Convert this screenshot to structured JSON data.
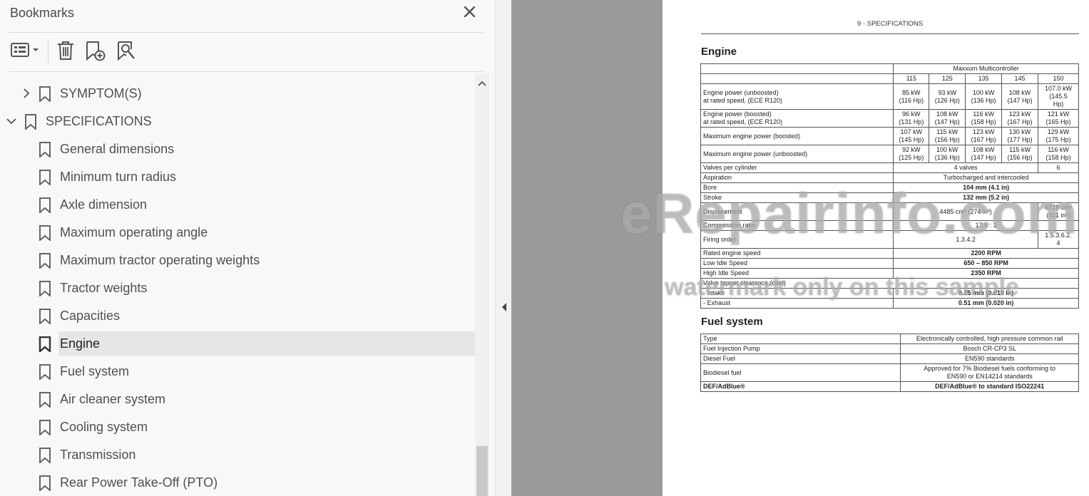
{
  "panel": {
    "title": "Bookmarks",
    "close_glyph": "✕",
    "toolbar": {
      "options_icon": "list-options-icon",
      "delete_icon": "trash-icon",
      "add_icon": "add-bookmark-icon",
      "find_icon": "find-bookmark-icon"
    },
    "items": [
      {
        "label": "SYMPTOM(S)",
        "level": 0,
        "expander": "collapsed"
      },
      {
        "label": "SPECIFICATIONS",
        "level": 0,
        "expander": "expanded"
      },
      {
        "label": "General dimensions",
        "level": 1
      },
      {
        "label": "Minimum turn radius",
        "level": 1
      },
      {
        "label": "Axle dimension",
        "level": 1
      },
      {
        "label": "Maximum operating angle",
        "level": 1
      },
      {
        "label": "Maximum tractor operating weights",
        "level": 1
      },
      {
        "label": "Tractor weights",
        "level": 1
      },
      {
        "label": "Capacities",
        "level": 1
      },
      {
        "label": "Engine",
        "level": 1,
        "selected": true
      },
      {
        "label": "Fuel system",
        "level": 1
      },
      {
        "label": "Air cleaner system",
        "level": 1
      },
      {
        "label": "Cooling system",
        "level": 1
      },
      {
        "label": "Transmission",
        "level": 1
      },
      {
        "label": "Rear Power Take-Off (PTO)",
        "level": 1
      }
    ]
  },
  "document": {
    "header": "9 - SPECIFICATIONS",
    "engine": {
      "title": "Engine",
      "group_header": "Maxxum Multicontroller",
      "models": [
        "115",
        "125",
        "135",
        "145",
        "150"
      ],
      "power_rows": [
        {
          "label": "Engine power (unboosted)\nat rated speed, (ECE R120)",
          "values": [
            "85 kW\n(116 Hp)",
            "93 kW\n(126 Hp)",
            "100 kW\n(136 Hp)",
            "108 kW\n(147 Hp)",
            "107.0 kW\n(145.5\nHp)"
          ]
        },
        {
          "label": "Engine power (boosted)\nat rated speed, (ECE R120)",
          "values": [
            "96 kW\n(131 Hp)",
            "108 kW\n(147 Hp)",
            "116 kW\n(158 Hp)",
            "123 kW\n(167 Hp)",
            "121 kW\n(165 Hp)"
          ]
        },
        {
          "label": "Maximum engine power (boosted)",
          "values": [
            "107 kW\n(145 Hp)",
            "115 kW\n(156 Hp)",
            "123 kW\n(167 Hp)",
            "130 kW\n(177 Hp)",
            "129 kW\n(175 Hp)"
          ]
        },
        {
          "label": "Maximum engine power (unboosted)",
          "values": [
            "92 kW\n(125 Hp)",
            "100 kW\n(136 Hp)",
            "108 kW\n(147 Hp)",
            "115 kW\n(156 Hp)",
            "116 kW\n(158 Hp)"
          ]
        }
      ],
      "valves": {
        "label": "Valves per cylinder",
        "left": "4 valves",
        "right": "6"
      },
      "aspiration": {
        "label": "Aspiration",
        "value": "Turbocharged and intercooled"
      },
      "bore": {
        "label": "Bore",
        "value": "104 mm (4.1 in)"
      },
      "stroke": {
        "label": "Stroke",
        "value": "132 mm (5.2 in)"
      },
      "displacement": {
        "label": "Displacement",
        "left": "4485 cm³ (274 in³)",
        "right": "6728 cm³\n(411 in³)"
      },
      "compression": {
        "label": "Compression ratio",
        "value": "17.5 : 1"
      },
      "firing": {
        "label": "Firing order",
        "left": "1.3.4.2",
        "right": "1.5.3.6.2.\n4"
      },
      "rated_speed": {
        "label": "Rated engine speed",
        "value": "2200 RPM"
      },
      "low_idle": {
        "label": "Low Idle Speed",
        "value": "650 – 850 RPM"
      },
      "high_idle": {
        "label": "High Idle Speed",
        "value": "2350 RPM"
      },
      "tappet": {
        "label": "Valve tappet clearance (cold)"
      },
      "intake": {
        "label": "- Intake",
        "value": "0.25 mm (0.010 in)"
      },
      "exhaust": {
        "label": "- Exhaust",
        "value": "0.51 mm (0.020 in)"
      }
    },
    "fuel": {
      "title": "Fuel system",
      "rows": [
        {
          "label": "Type",
          "value": "Electronically controlled, high pressure common rail",
          "bold": false
        },
        {
          "label": "Fuel Injection Pump",
          "value": "Bosch CR-CP3 SL",
          "bold": false
        },
        {
          "label": "Diesel Fuel",
          "value": "EN590 standards",
          "bold": false
        },
        {
          "label": "Biodiesel fuel",
          "value": "Approved for 7% Biodiesel fuels conforming to\nEN590 or EN14214 standards",
          "bold": false
        },
        {
          "label": "DEF/AdBlue®",
          "value": "DEF/AdBlue® to standard ISO22241",
          "bold": true
        }
      ]
    },
    "watermark": {
      "main": "eRepairinfo.com",
      "sub": "watermark only on this sample"
    }
  }
}
